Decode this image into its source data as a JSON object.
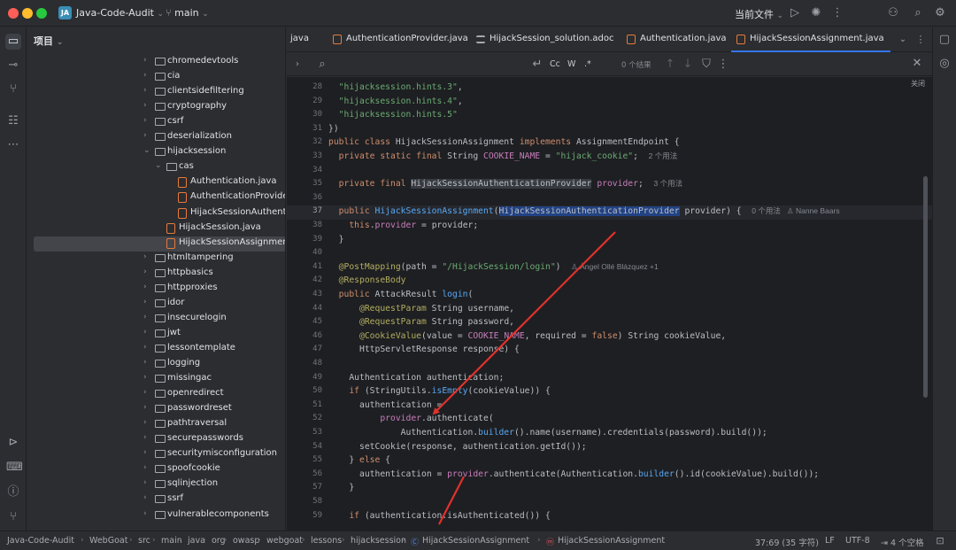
{
  "titlebar": {
    "project_badge": "JA",
    "project_name": "Java-Code-Audit",
    "branch": "main",
    "run_config": "当前文件",
    "icons": [
      "chevron-down-icon",
      "run-icon",
      "debug-icon",
      "more-icon",
      "add-user-icon",
      "search-icon",
      "settings-icon"
    ]
  },
  "sidebar": {
    "title": "项目",
    "items": [
      {
        "label": "chromedevtools",
        "type": "folder",
        "depth": 0
      },
      {
        "label": "cia",
        "type": "folder",
        "depth": 0
      },
      {
        "label": "clientsidefiltering",
        "type": "folder",
        "depth": 0
      },
      {
        "label": "cryptography",
        "type": "folder",
        "depth": 0
      },
      {
        "label": "csrf",
        "type": "folder",
        "depth": 0
      },
      {
        "label": "deserialization",
        "type": "folder",
        "depth": 0
      },
      {
        "label": "hijacksession",
        "type": "folder",
        "depth": 0,
        "expanded": true
      },
      {
        "label": "cas",
        "type": "folder",
        "depth": 1,
        "expanded": true
      },
      {
        "label": "Authentication.java",
        "type": "java",
        "depth": 2
      },
      {
        "label": "AuthenticationProvider.ja",
        "type": "java",
        "depth": 2
      },
      {
        "label": "HijackSessionAuthentica",
        "type": "java",
        "depth": 2
      },
      {
        "label": "HijackSession.java",
        "type": "java",
        "depth": 1
      },
      {
        "label": "HijackSessionAssignment.ja",
        "type": "java",
        "depth": 1,
        "selected": true
      },
      {
        "label": "htmltampering",
        "type": "folder",
        "depth": 0
      },
      {
        "label": "httpbasics",
        "type": "folder",
        "depth": 0
      },
      {
        "label": "httpproxies",
        "type": "folder",
        "depth": 0
      },
      {
        "label": "idor",
        "type": "folder",
        "depth": 0
      },
      {
        "label": "insecurelogin",
        "type": "folder",
        "depth": 0
      },
      {
        "label": "jwt",
        "type": "folder",
        "depth": 0
      },
      {
        "label": "lessontemplate",
        "type": "folder",
        "depth": 0
      },
      {
        "label": "logging",
        "type": "folder",
        "depth": 0
      },
      {
        "label": "missingac",
        "type": "folder",
        "depth": 0
      },
      {
        "label": "openredirect",
        "type": "folder",
        "depth": 0
      },
      {
        "label": "passwordreset",
        "type": "folder",
        "depth": 0
      },
      {
        "label": "pathtraversal",
        "type": "folder",
        "depth": 0
      },
      {
        "label": "securepasswords",
        "type": "folder",
        "depth": 0
      },
      {
        "label": "securitymisconfiguration",
        "type": "folder",
        "depth": 0
      },
      {
        "label": "spoofcookie",
        "type": "folder",
        "depth": 0
      },
      {
        "label": "sqlinjection",
        "type": "folder",
        "depth": 0
      },
      {
        "label": "ssrf",
        "type": "folder",
        "depth": 0
      },
      {
        "label": "vulnerablecomponents",
        "type": "folder",
        "depth": 0
      }
    ]
  },
  "tabs": [
    {
      "label": "java",
      "icon": ""
    },
    {
      "label": "AuthenticationProvider.java",
      "icon": "java-file-icon"
    },
    {
      "label": "HijackSession_solution.adoc",
      "icon": "adoc-file-icon"
    },
    {
      "label": "Authentication.java",
      "icon": "java-file-icon"
    },
    {
      "label": "HijackSessionAssignment.java",
      "icon": "java-file-icon",
      "active": true
    }
  ],
  "find": {
    "match_case": "Cc",
    "words": "W",
    "regex": ".*",
    "results": "0 个结果",
    "close_hint": "关闭"
  },
  "editor": {
    "current_line": 37,
    "lines": [
      {
        "n": 28,
        "segs": [
          {
            "t": "  "
          },
          {
            "t": "\"hijacksession.hints.3\"",
            "c": "str"
          },
          {
            "t": ","
          }
        ]
      },
      {
        "n": 29,
        "segs": [
          {
            "t": "  "
          },
          {
            "t": "\"hijacksession.hints.4\"",
            "c": "str"
          },
          {
            "t": ","
          }
        ]
      },
      {
        "n": 30,
        "segs": [
          {
            "t": "  "
          },
          {
            "t": "\"hijacksession.hints.5\"",
            "c": "str"
          }
        ]
      },
      {
        "n": 31,
        "segs": [
          {
            "t": "})"
          }
        ]
      },
      {
        "n": 32,
        "segs": [
          {
            "t": "public class ",
            "c": "kw"
          },
          {
            "t": "HijackSessionAssignment "
          },
          {
            "t": "implements ",
            "c": "kw"
          },
          {
            "t": "AssignmentEndpoint {"
          }
        ]
      },
      {
        "n": 33,
        "segs": [
          {
            "t": "  "
          },
          {
            "t": "private static final ",
            "c": "kw"
          },
          {
            "t": "String "
          },
          {
            "t": "COOKIE_NAME",
            "c": "fld"
          },
          {
            "t": " = "
          },
          {
            "t": "\"hijack_cookie\"",
            "c": "str"
          },
          {
            "t": ";  "
          },
          {
            "t": "2 个用法",
            "c": "hint"
          }
        ]
      },
      {
        "n": 34,
        "segs": []
      },
      {
        "n": 35,
        "segs": [
          {
            "t": "  "
          },
          {
            "t": "private final ",
            "c": "kw"
          },
          {
            "t": "HijackSessionAuthenticationProvider",
            "c": "hl"
          },
          {
            "t": " "
          },
          {
            "t": "provider",
            "c": "fld"
          },
          {
            "t": ";  "
          },
          {
            "t": "3 个用法",
            "c": "hint"
          }
        ]
      },
      {
        "n": 36,
        "segs": []
      },
      {
        "n": 37,
        "segs": [
          {
            "t": "  "
          },
          {
            "t": "public ",
            "c": "kw"
          },
          {
            "t": "HijackSessionAssignment",
            "c": "fn"
          },
          {
            "t": "("
          },
          {
            "t": "HijackSessionAuthenticationProvider",
            "c": "hlsel"
          },
          {
            "t": " provider) {  "
          },
          {
            "t": "0 个用法   ♙ Nanne Baars",
            "c": "hint"
          }
        ]
      },
      {
        "n": 38,
        "segs": [
          {
            "t": "    "
          },
          {
            "t": "this",
            "c": "kw"
          },
          {
            "t": "."
          },
          {
            "t": "provider",
            "c": "fld"
          },
          {
            "t": " = provider;"
          }
        ]
      },
      {
        "n": 39,
        "segs": [
          {
            "t": "  }"
          }
        ]
      },
      {
        "n": 40,
        "segs": []
      },
      {
        "n": 41,
        "segs": [
          {
            "t": "  "
          },
          {
            "t": "@PostMapping",
            "c": "ann"
          },
          {
            "t": "(path = "
          },
          {
            "t": "\"/HijackSession/login\"",
            "c": "str"
          },
          {
            "t": ")  "
          },
          {
            "t": "♙ Àngel Ollé Blázquez +1",
            "c": "hint"
          }
        ]
      },
      {
        "n": 42,
        "segs": [
          {
            "t": "  "
          },
          {
            "t": "@ResponseBody",
            "c": "ann"
          }
        ]
      },
      {
        "n": 43,
        "segs": [
          {
            "t": "  "
          },
          {
            "t": "public ",
            "c": "kw"
          },
          {
            "t": "AttackResult "
          },
          {
            "t": "login",
            "c": "fn"
          },
          {
            "t": "("
          }
        ]
      },
      {
        "n": 44,
        "segs": [
          {
            "t": "      "
          },
          {
            "t": "@RequestParam",
            "c": "ann"
          },
          {
            "t": " String username,"
          }
        ]
      },
      {
        "n": 45,
        "segs": [
          {
            "t": "      "
          },
          {
            "t": "@RequestParam",
            "c": "ann"
          },
          {
            "t": " String password,"
          }
        ]
      },
      {
        "n": 46,
        "segs": [
          {
            "t": "      "
          },
          {
            "t": "@CookieValue",
            "c": "ann"
          },
          {
            "t": "(value = "
          },
          {
            "t": "COOKIE_NAME",
            "c": "fld"
          },
          {
            "t": ", required = "
          },
          {
            "t": "false",
            "c": "kw"
          },
          {
            "t": ") String cookieValue,"
          }
        ]
      },
      {
        "n": 47,
        "segs": [
          {
            "t": "      HttpServletResponse response) {"
          }
        ]
      },
      {
        "n": 48,
        "segs": []
      },
      {
        "n": 49,
        "segs": [
          {
            "t": "    Authentication authentication;"
          }
        ]
      },
      {
        "n": 50,
        "segs": [
          {
            "t": "    "
          },
          {
            "t": "if ",
            "c": "kw"
          },
          {
            "t": "(StringUtils."
          },
          {
            "t": "isEmpty",
            "c": "fn"
          },
          {
            "t": "(cookieValue)) {"
          }
        ]
      },
      {
        "n": 51,
        "segs": [
          {
            "t": "      authentication ="
          }
        ]
      },
      {
        "n": 52,
        "segs": [
          {
            "t": "          "
          },
          {
            "t": "provider",
            "c": "fld"
          },
          {
            "t": ".authenticate("
          }
        ]
      },
      {
        "n": 53,
        "segs": [
          {
            "t": "              Authentication."
          },
          {
            "t": "builder",
            "c": "fn"
          },
          {
            "t": "().name(username).credentials(password).build());"
          }
        ]
      },
      {
        "n": 54,
        "segs": [
          {
            "t": "      setCookie(response, authentication.getId());"
          }
        ]
      },
      {
        "n": 55,
        "segs": [
          {
            "t": "    } "
          },
          {
            "t": "else ",
            "c": "kw"
          },
          {
            "t": "{"
          }
        ]
      },
      {
        "n": 56,
        "segs": [
          {
            "t": "      authentication = "
          },
          {
            "t": "provider",
            "c": "fld"
          },
          {
            "t": ".authenticate(Authentication."
          },
          {
            "t": "builder",
            "c": "fn"
          },
          {
            "t": "().id(cookieValue).build());"
          }
        ]
      },
      {
        "n": 57,
        "segs": [
          {
            "t": "    }"
          }
        ]
      },
      {
        "n": 58,
        "segs": []
      },
      {
        "n": 59,
        "segs": [
          {
            "t": "    "
          },
          {
            "t": "if ",
            "c": "kw"
          },
          {
            "t": "(authentication.isAuthenticated()) {"
          }
        ]
      }
    ]
  },
  "statusbar": {
    "breadcrumbs": [
      "Java-Code-Audit",
      "WebGoat",
      "src",
      "main",
      "java",
      "org",
      "owasp",
      "webgoat",
      "lessons",
      "hijacksession",
      "HijackSessionAssignment",
      "HijackSessionAssignment"
    ],
    "position": "37:69 (35 字符)",
    "line_ending": "LF",
    "encoding": "UTF-8",
    "indent": "4 个空格"
  },
  "annotations": {
    "arrow_color": "#e0322c"
  }
}
